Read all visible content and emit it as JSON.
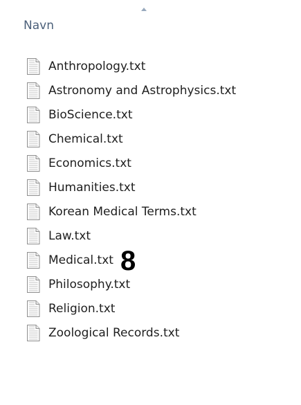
{
  "header": {
    "column_title": "Navn",
    "sort_icon": "sort-ascending-icon"
  },
  "files": [
    {
      "name": "Anthropology.txt",
      "icon": "text-file-icon"
    },
    {
      "name": "Astronomy and Astrophysics.txt",
      "icon": "text-file-icon"
    },
    {
      "name": "BioScience.txt",
      "icon": "text-file-icon"
    },
    {
      "name": "Chemical.txt",
      "icon": "text-file-icon"
    },
    {
      "name": "Economics.txt",
      "icon": "text-file-icon"
    },
    {
      "name": "Humanities.txt",
      "icon": "text-file-icon"
    },
    {
      "name": "Korean Medical Terms.txt",
      "icon": "text-file-icon"
    },
    {
      "name": "Law.txt",
      "icon": "text-file-icon"
    },
    {
      "name": "Medical.txt",
      "icon": "text-file-icon"
    },
    {
      "name": "Philosophy.txt",
      "icon": "text-file-icon"
    },
    {
      "name": "Religion.txt",
      "icon": "text-file-icon"
    },
    {
      "name": "Zoological Records.txt",
      "icon": "text-file-icon"
    }
  ],
  "annotation": {
    "label": "8"
  }
}
